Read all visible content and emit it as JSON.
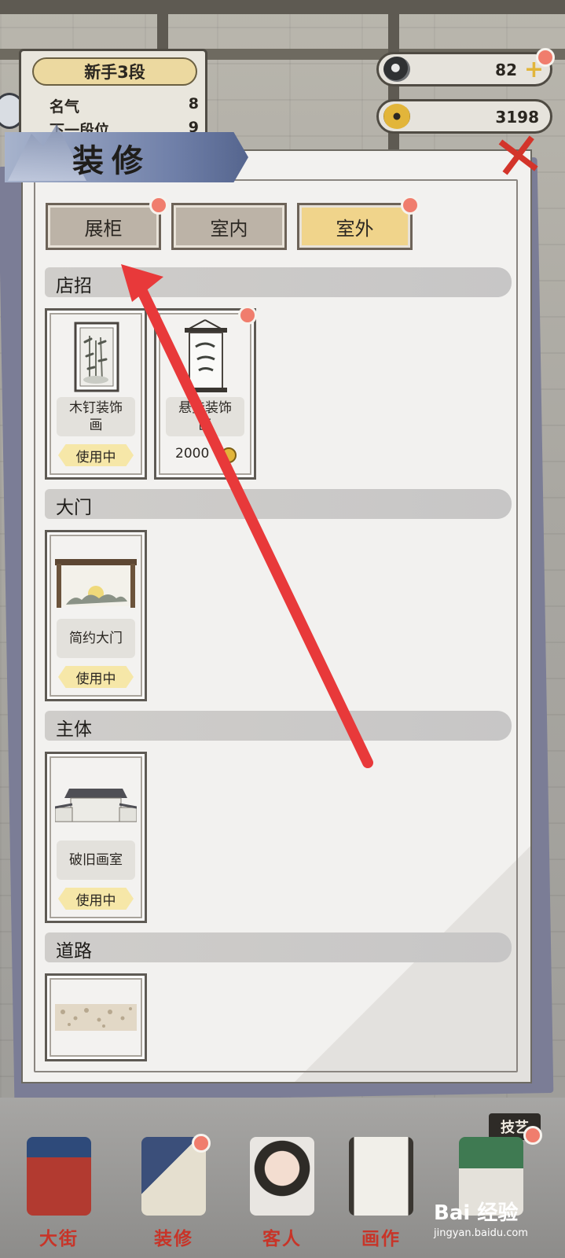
{
  "colors": {
    "accent_red": "#d3342a",
    "tab_active": "#f0d48b",
    "tab_inactive": "#bcb3a7",
    "badge_in_use": "#f6e7a8",
    "notification_dot": "#f07d6d"
  },
  "player": {
    "rank_title": "新手3段",
    "fame_label": "名气",
    "fame_value": "8",
    "next_rank_label": "下一段位",
    "next_rank_value": "9"
  },
  "currency": {
    "gems": "82",
    "gems_icon": "swirl-token-icon",
    "coins": "3198",
    "coins_icon": "square-hole-coin-icon"
  },
  "panel": {
    "title": "装修",
    "close_icon": "close-icon"
  },
  "tabs": [
    {
      "label": "展柜",
      "active": false,
      "has_dot": true
    },
    {
      "label": "室内",
      "active": false,
      "has_dot": false
    },
    {
      "label": "室外",
      "active": true,
      "has_dot": true
    }
  ],
  "sections": [
    {
      "title": "店招",
      "items": [
        {
          "name": "木钉装饰\n画",
          "status": "使用中",
          "art_icon": "bamboo-painting-icon"
        },
        {
          "name": "悬挂装饰\n画",
          "price": "2000",
          "has_dot": true,
          "art_icon": "hanging-scroll-icon"
        }
      ]
    },
    {
      "title": "大门",
      "items": [
        {
          "name": "简约大门",
          "status": "使用中",
          "art_icon": "simple-gate-icon"
        }
      ]
    },
    {
      "title": "主体",
      "items": [
        {
          "name": "破旧画室",
          "status": "使用中",
          "art_icon": "old-studio-icon"
        }
      ]
    },
    {
      "title": "道路",
      "items": [
        {
          "art_icon": "gravel-road-icon"
        }
      ]
    }
  ],
  "bottom_nav": [
    {
      "label": "大街",
      "icon": "street-gate-icon"
    },
    {
      "label": "装修",
      "icon": "decoration-book-icon"
    },
    {
      "label": "客人",
      "icon": "guest-girl-icon"
    },
    {
      "label": "画作",
      "icon": "painting-scroll-icon"
    },
    {
      "label": "",
      "icon": "jade-tools-icon"
    }
  ],
  "skill_tag": "技艺",
  "watermark": {
    "brand": "Bai 经验",
    "url": "jingyan.baidu.com"
  }
}
